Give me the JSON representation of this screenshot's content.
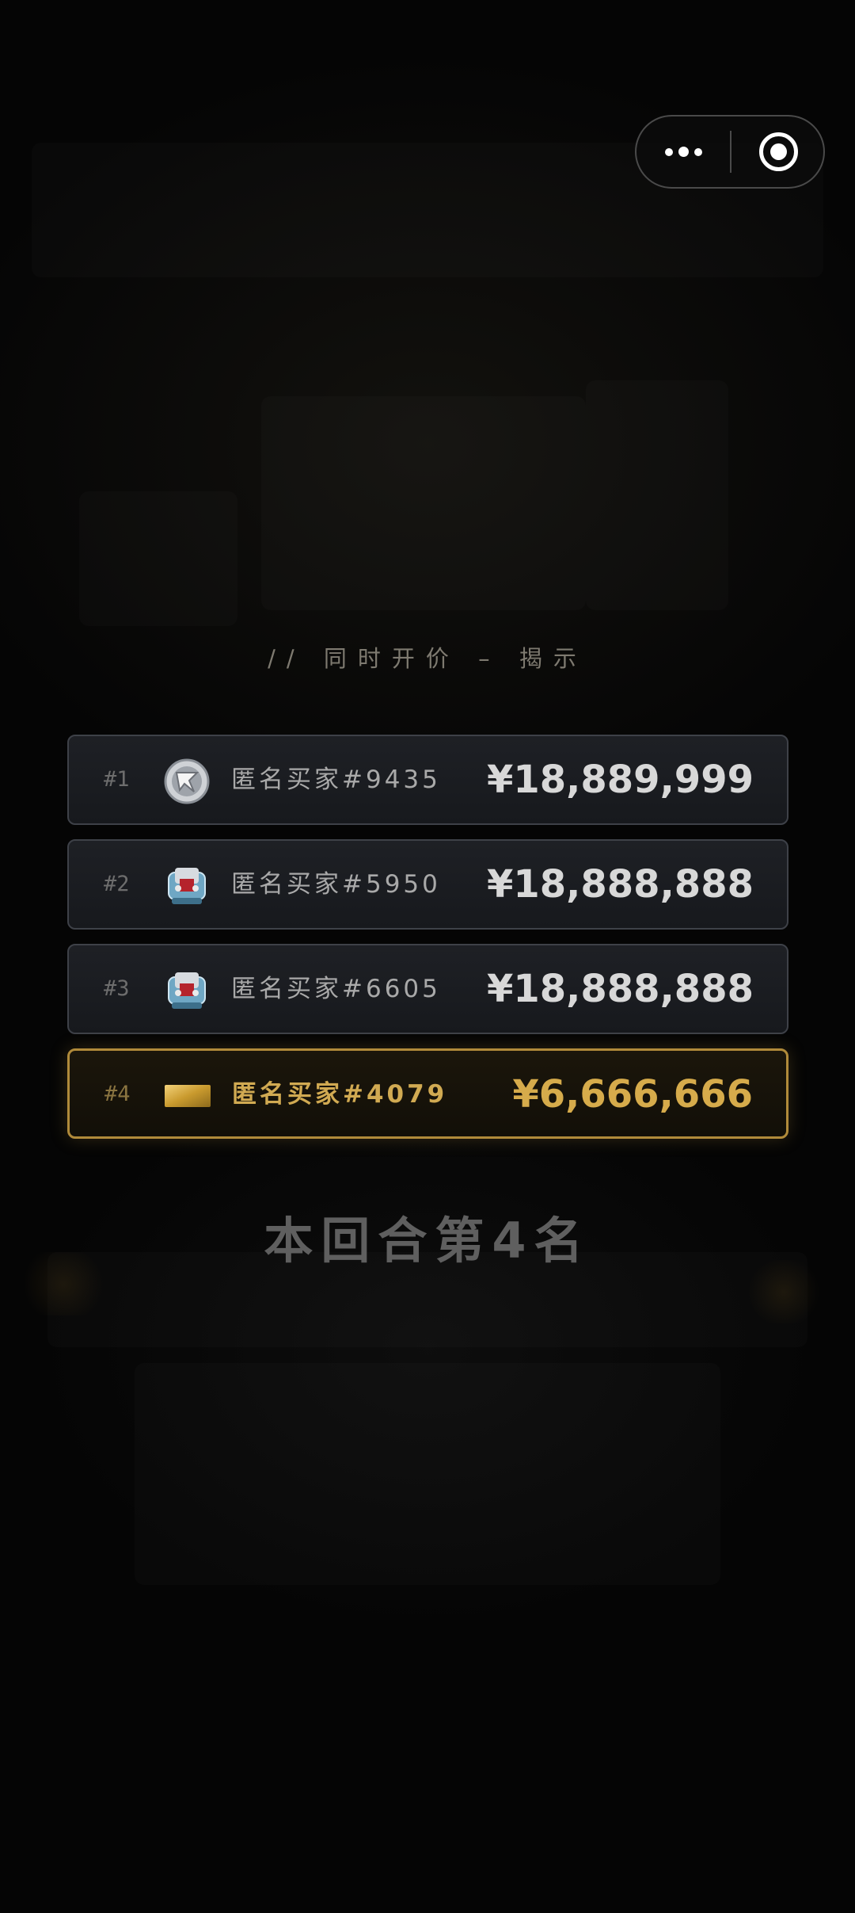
{
  "capsule": {
    "more_icon": "more-dots-icon",
    "close_icon": "record-circle-icon"
  },
  "subtitle": "//  同时开价 – 揭示",
  "bids": [
    {
      "rank": "#1",
      "avatar_icon": "emblem-avatar-icon",
      "name": "匿名买家#9435",
      "price": "¥18,889,999",
      "highlight": false
    },
    {
      "rank": "#2",
      "avatar_icon": "robot-avatar-icon",
      "name": "匿名买家#5950",
      "price": "¥18,888,888",
      "highlight": false
    },
    {
      "rank": "#3",
      "avatar_icon": "robot-avatar-icon",
      "name": "匿名买家#6605",
      "price": "¥18,888,888",
      "highlight": false
    },
    {
      "rank": "#4",
      "avatar_icon": "gold-bar-avatar-icon",
      "name": "匿名买家#4079",
      "price": "¥6,666,666",
      "highlight": true
    }
  ],
  "result_text": "本回合第4名",
  "colors": {
    "background": "#050505",
    "highlight_gold": "#d6ab4b",
    "row_border": "#3e4148",
    "highlight_border": "#b08a3a"
  }
}
